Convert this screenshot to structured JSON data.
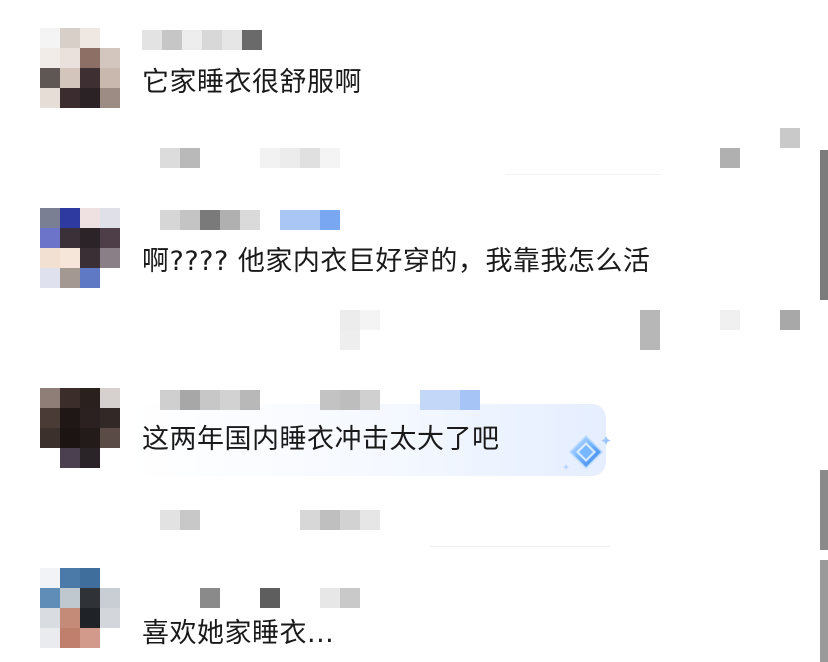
{
  "comments": [
    {
      "text": "它家睡衣很舒服啊"
    },
    {
      "text": "啊????  他家内衣巨好穿的，我靠我怎么活"
    },
    {
      "text": "这两年国内睡衣冲击太大了吧"
    },
    {
      "text": "喜欢她家睡衣..."
    }
  ],
  "icons": {
    "badge": "diamond-badge-icon"
  },
  "colors": {
    "text": "#1a1a1a",
    "accent_blue": "#7aa7f2",
    "blur_gray": "#b5b5b5"
  }
}
